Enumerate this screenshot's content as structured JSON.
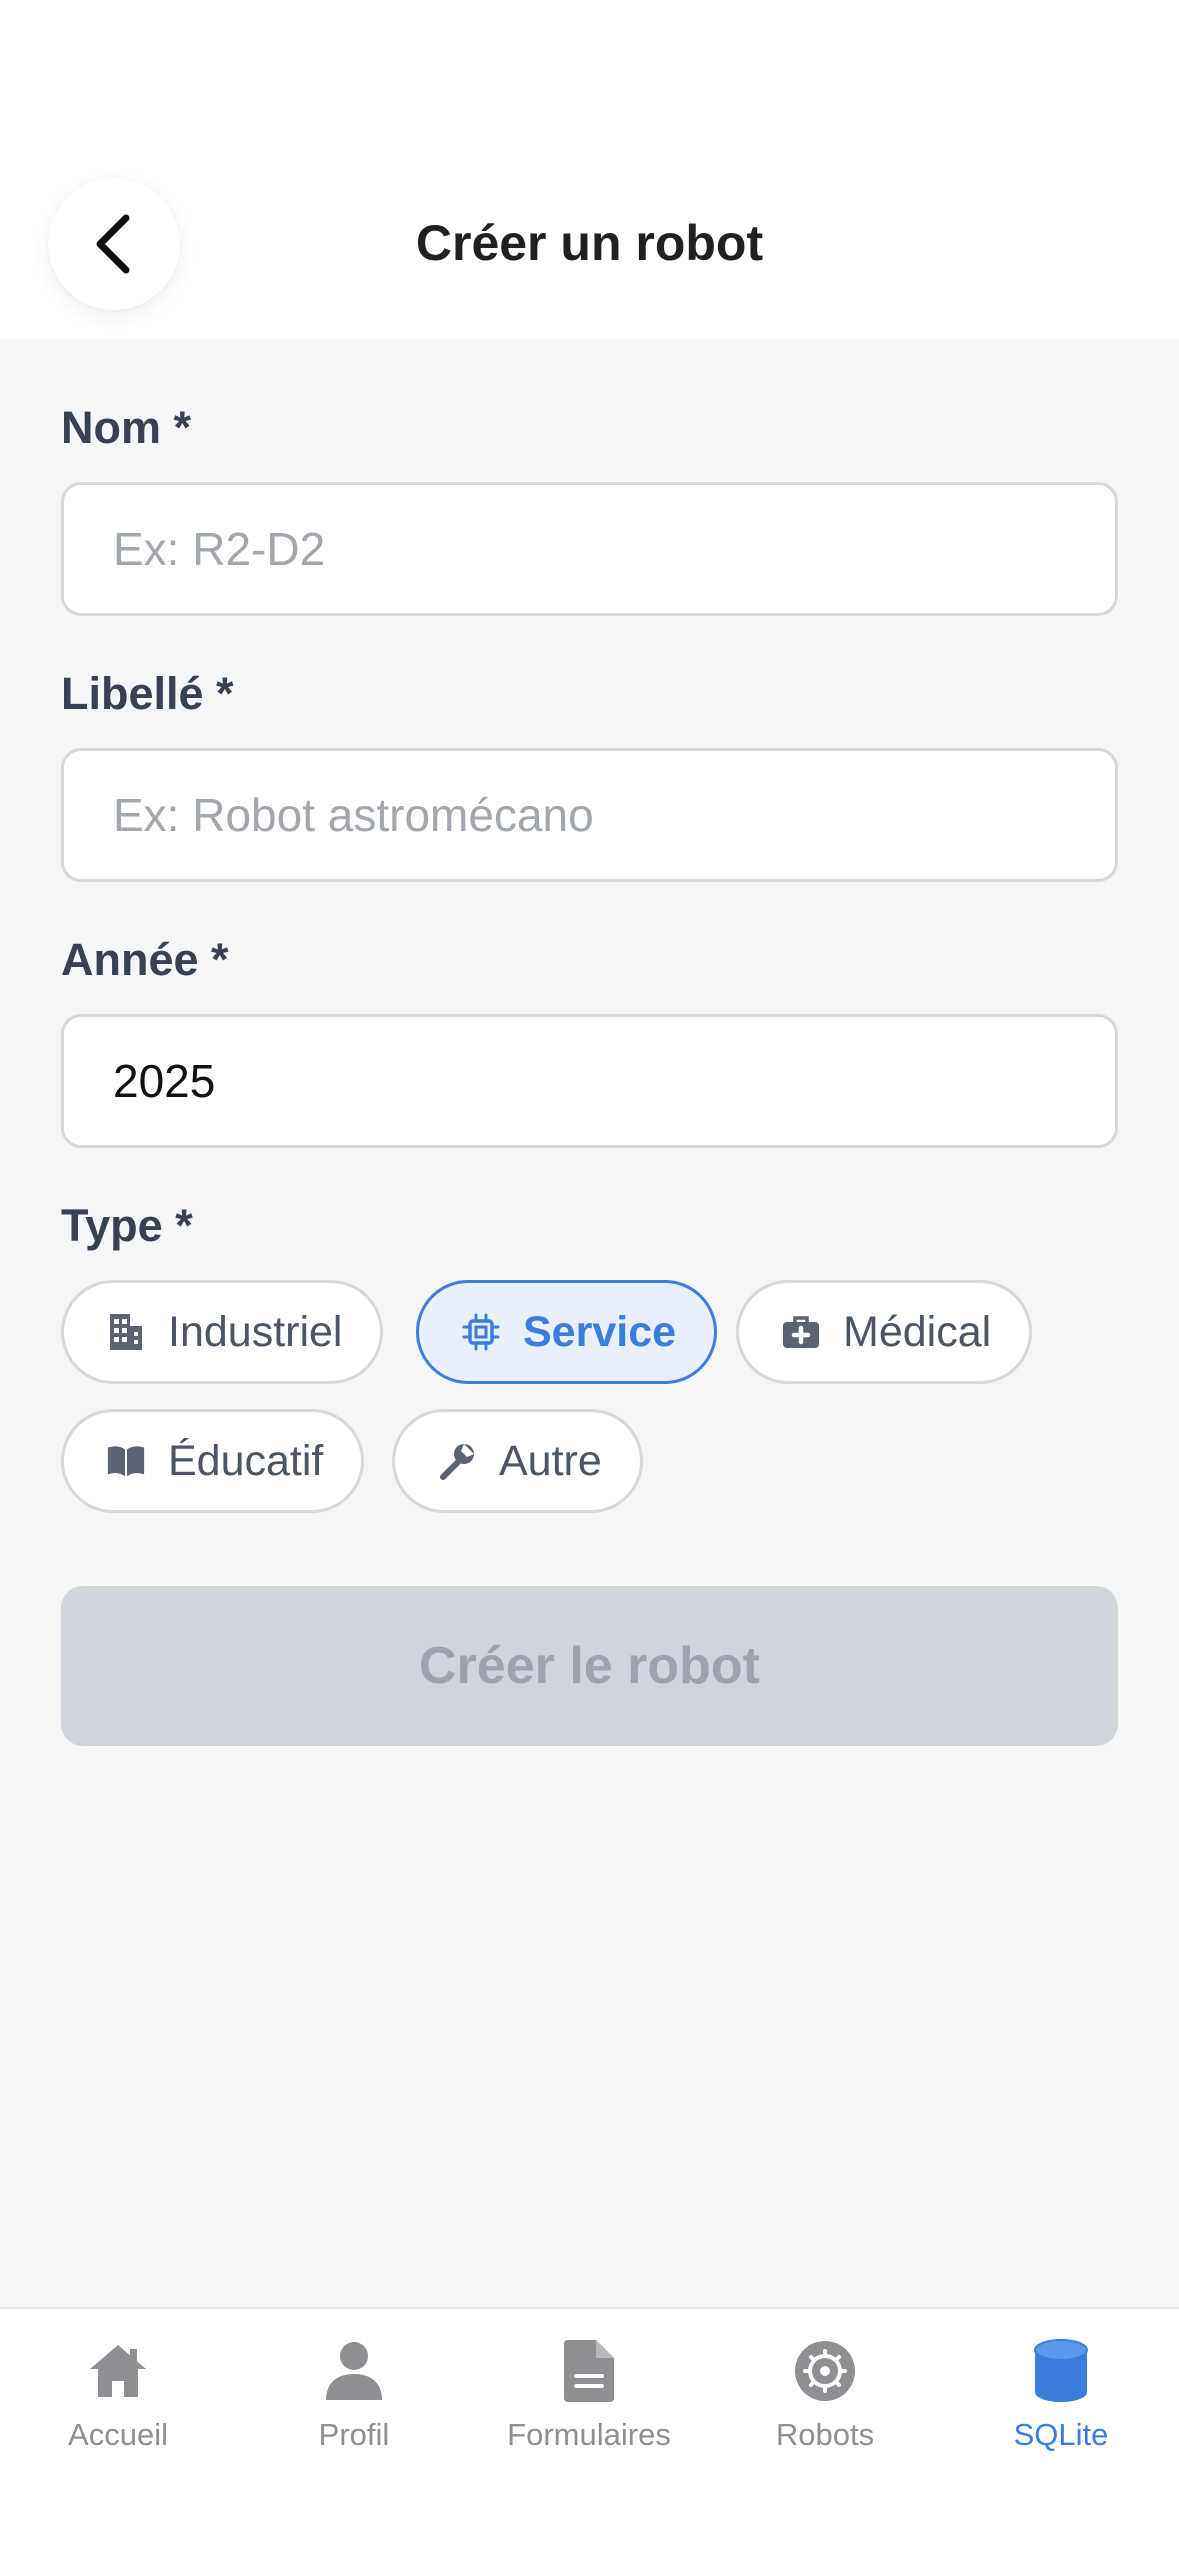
{
  "header": {
    "title": "Créer un robot",
    "back_icon": "chevron-left-icon"
  },
  "form": {
    "nom": {
      "label": "Nom *",
      "placeholder": "Ex: R2-D2",
      "value": ""
    },
    "libelle": {
      "label": "Libellé *",
      "placeholder": "Ex: Robot astromécano",
      "value": ""
    },
    "annee": {
      "label": "Année *",
      "value": "2025"
    },
    "type": {
      "label": "Type *",
      "selected": "Service",
      "options": [
        {
          "label": "Industriel",
          "icon": "building-icon"
        },
        {
          "label": "Service",
          "icon": "chip-icon"
        },
        {
          "label": "Médical",
          "icon": "medkit-icon"
        },
        {
          "label": "Éducatif",
          "icon": "book-icon"
        },
        {
          "label": "Autre",
          "icon": "wrench-icon"
        }
      ]
    },
    "submit_label": "Créer le robot"
  },
  "tabbar": {
    "active": "SQLite",
    "tabs": [
      {
        "label": "Accueil",
        "icon": "home-icon"
      },
      {
        "label": "Profil",
        "icon": "person-icon"
      },
      {
        "label": "Formulaires",
        "icon": "document-icon"
      },
      {
        "label": "Robots",
        "icon": "robot-icon"
      },
      {
        "label": "SQLite",
        "icon": "database-icon"
      }
    ]
  },
  "colors": {
    "accent": "#3b7ddd",
    "background": "#f5f6f8",
    "disabled_button": "#d1d5db",
    "label": "#374151",
    "inactive_tab": "#8e8e93"
  }
}
